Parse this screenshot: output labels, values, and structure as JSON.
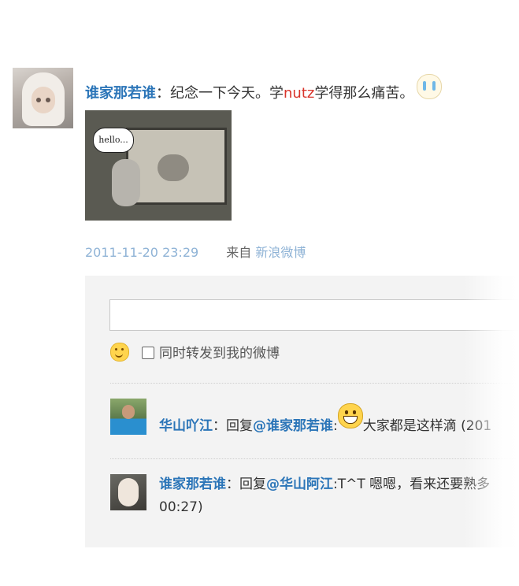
{
  "post": {
    "author": "谁家那若谁",
    "colon": "：",
    "text_before": "纪念一下今天。学",
    "highlight": "nutz",
    "text_after": "学得那么痛苦。",
    "emoji": "cry-emoji-icon",
    "photo_bubble": "hello...",
    "timestamp": "2011-11-20 23:29",
    "from_label": "来自",
    "source": "新浪微博"
  },
  "composer": {
    "input_value": "",
    "checkbox_label": "同时转发到我的微博",
    "checked": false
  },
  "comments": [
    {
      "author": "华山吖江",
      "colon": "：",
      "reply_label": "回复",
      "mention": "@谁家那若谁",
      "mention_colon": ":",
      "emoji": "grin-emoji-icon",
      "text": "大家都是这样滴 (201"
    },
    {
      "author": "谁家那若谁",
      "colon": "：",
      "reply_label": "回复",
      "mention": "@华山阿江",
      "text": ":T^T 嗯嗯，看来还要熟多",
      "text_line2": "00:27)"
    }
  ],
  "colors": {
    "link": "#2b75b8",
    "timestamp": "#8fb3d6",
    "highlight": "#d9342b",
    "panel": "#f3f3f3"
  }
}
